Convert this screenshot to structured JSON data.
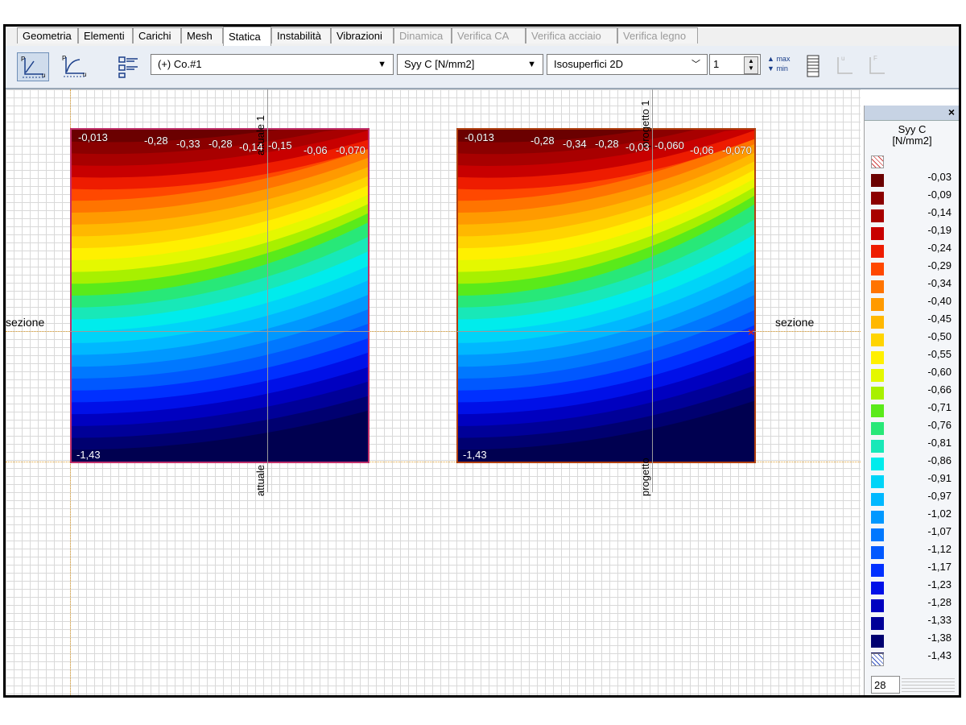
{
  "tabs": [
    {
      "label": "Geometria",
      "state": "normal"
    },
    {
      "label": "Elementi",
      "state": "normal"
    },
    {
      "label": "Carichi",
      "state": "normal"
    },
    {
      "label": "Mesh",
      "state": "normal"
    },
    {
      "label": "Statica",
      "state": "active"
    },
    {
      "label": "Instabilità",
      "state": "normal"
    },
    {
      "label": "Vibrazioni",
      "state": "normal"
    },
    {
      "label": "Dinamica",
      "state": "disabled"
    },
    {
      "label": "Verifica CA",
      "state": "disabled"
    },
    {
      "label": "Verifica acciaio",
      "state": "disabled"
    },
    {
      "label": "Verifica legno",
      "state": "disabled"
    }
  ],
  "toolbar": {
    "combo_case": "(+) Co.#1",
    "combo_quantity": "Syy C [N/mm2]",
    "combo_view": "Isosuperfici 2D",
    "spin_value": "1",
    "max_label": "max",
    "min_label": "min"
  },
  "canvas": {
    "section_label_left": "sezione",
    "section_label_right": "sezione",
    "plot_left": {
      "vlabel_top": "attuale 1",
      "vlabel_bottom": "attuale",
      "top_values": [
        "-0,013",
        "-0,28",
        "-0,33",
        "-0,28",
        "-0,14",
        "-0,15",
        "-0,06",
        "-0,070"
      ],
      "bottom_value": "-1,43"
    },
    "plot_right": {
      "vlabel_top": "progetto 1",
      "vlabel_bottom": "progetto",
      "top_values": [
        "-0,013",
        "-0,28",
        "-0,34",
        "-0,28",
        "-0,03",
        "-0,060",
        "-0,06",
        "-0,070"
      ],
      "bottom_value": "-1,43"
    }
  },
  "legend": {
    "title_line1": "Syy C",
    "title_line2": "[N/mm2]",
    "entries": [
      {
        "value": "-0,03",
        "color": "#6b0000"
      },
      {
        "value": "-0,09",
        "color": "#8b0000"
      },
      {
        "value": "-0,14",
        "color": "#a80000"
      },
      {
        "value": "-0,19",
        "color": "#c80000"
      },
      {
        "value": "-0,24",
        "color": "#ee1c00"
      },
      {
        "value": "-0,29",
        "color": "#ff4800"
      },
      {
        "value": "-0,34",
        "color": "#ff7400"
      },
      {
        "value": "-0,40",
        "color": "#ff9a00"
      },
      {
        "value": "-0,45",
        "color": "#ffb800"
      },
      {
        "value": "-0,50",
        "color": "#ffd400"
      },
      {
        "value": "-0,55",
        "color": "#fff000"
      },
      {
        "value": "-0,60",
        "color": "#e4f800"
      },
      {
        "value": "-0,66",
        "color": "#a8f000"
      },
      {
        "value": "-0,71",
        "color": "#5aea1a"
      },
      {
        "value": "-0,76",
        "color": "#28e878"
      },
      {
        "value": "-0,81",
        "color": "#18e8b8"
      },
      {
        "value": "-0,86",
        "color": "#00ecec"
      },
      {
        "value": "-0,91",
        "color": "#00d4f8"
      },
      {
        "value": "-0,97",
        "color": "#00b8ff"
      },
      {
        "value": "-1,02",
        "color": "#0098ff"
      },
      {
        "value": "-1,07",
        "color": "#0078ff"
      },
      {
        "value": "-1,12",
        "color": "#0058ff"
      },
      {
        "value": "-1,17",
        "color": "#0030ff"
      },
      {
        "value": "-1,23",
        "color": "#0010e8"
      },
      {
        "value": "-1,28",
        "color": "#0000c0"
      },
      {
        "value": "-1,33",
        "color": "#000098"
      },
      {
        "value": "-1,38",
        "color": "#000070"
      },
      {
        "value": "-1,43",
        "color": "#000050"
      }
    ],
    "count_value": "28"
  }
}
